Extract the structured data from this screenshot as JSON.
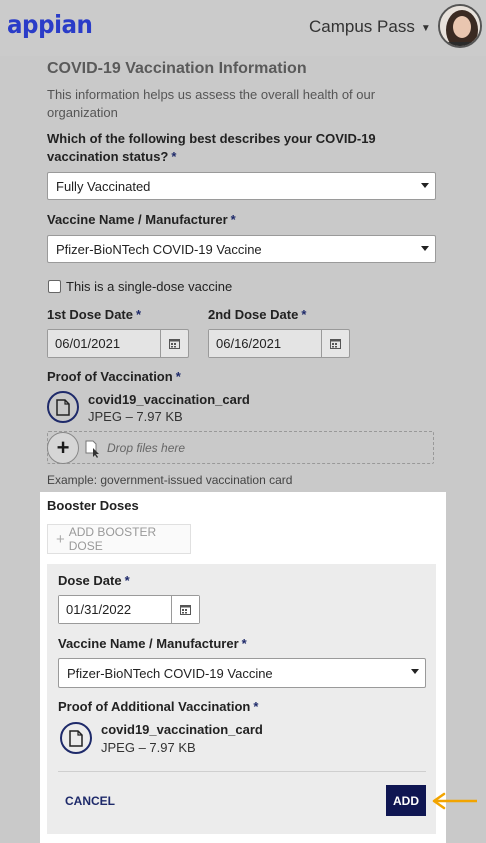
{
  "header": {
    "logo": "appian",
    "site_menu": "Campus Pass"
  },
  "form": {
    "title": "COVID-19 Vaccination Information",
    "description": "This information helps us assess the overall health of our organization",
    "status_question_line1": "Which of the following best describes your COVID-19",
    "status_question_line2": "vaccination status?",
    "status_value": "Fully Vaccinated",
    "vaccine_label": "Vaccine Name / Manufacturer",
    "vaccine_value": "Pfizer-BioNTech COVID-19 Vaccine",
    "single_dose_label": "This is a single-dose vaccine",
    "dose1_label": "1st Dose Date",
    "dose1_value": "06/01/2021",
    "dose2_label": "2nd Dose Date",
    "dose2_value": "06/16/2021",
    "proof_label": "Proof of Vaccination",
    "proof_file_name": "covid19_vaccination_card",
    "proof_file_meta": "JPEG – 7.97 KB",
    "drop_placeholder": "Drop files here",
    "proof_hint": "Example: government-issued vaccination card",
    "required_marker": "*"
  },
  "booster": {
    "title": "Booster Doses",
    "add_button": "ADD BOOSTER DOSE",
    "dose_date_label": "Dose Date",
    "dose_date_value": "01/31/2022",
    "vaccine_label": "Vaccine Name / Manufacturer",
    "vaccine_value": "Pfizer-BioNTech COVID-19 Vaccine",
    "proof_label": "Proof of Additional Vaccination",
    "file_name": "covid19_vaccination_card",
    "file_meta": "JPEG – 7.97 KB",
    "cancel_button": "CANCEL",
    "add_button_primary": "ADD"
  },
  "colors": {
    "accent": "#1e2a6a",
    "primary_button": "#0f1652",
    "annotation_arrow": "#f2a400",
    "logo": "#2a3cc8"
  }
}
